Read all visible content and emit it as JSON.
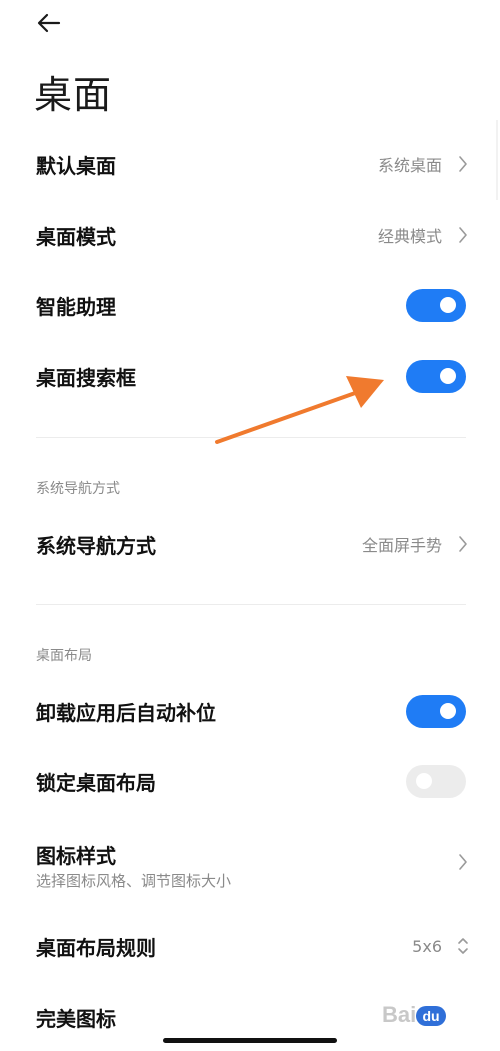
{
  "header": {
    "title": "桌面"
  },
  "settings": {
    "default_desktop": {
      "label": "默认桌面",
      "value": "系统桌面"
    },
    "desktop_mode": {
      "label": "桌面模式",
      "value": "经典模式"
    },
    "smart_assistant": {
      "label": "智能助理",
      "enabled": true
    },
    "desktop_search_box": {
      "label": "桌面搜索框",
      "enabled": true
    }
  },
  "navigation_section": {
    "header": "系统导航方式",
    "nav_mode": {
      "label": "系统导航方式",
      "value": "全面屏手势"
    }
  },
  "layout_section": {
    "header": "桌面布局",
    "auto_fill": {
      "label": "卸载应用后自动补位",
      "enabled": true
    },
    "lock_layout": {
      "label": "锁定桌面布局",
      "enabled": false
    },
    "icon_style": {
      "label": "图标样式",
      "sublabel": "选择图标风格、调节图标大小"
    },
    "layout_rule": {
      "label": "桌面布局规则",
      "value": "5x6"
    },
    "perfect_icons": {
      "label": "完美图标"
    }
  },
  "overlay": {
    "arrow_color": "#f07a2e",
    "watermark_text": "Bai",
    "watermark_badge": "du"
  },
  "colors": {
    "toggle_on": "#1f7cf5",
    "toggle_off": "#ececec",
    "secondary_text": "#8a8a8a"
  }
}
